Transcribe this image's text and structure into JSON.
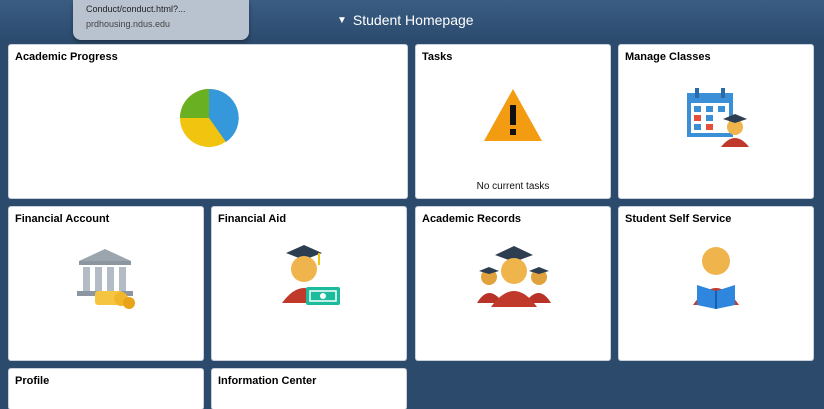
{
  "browser_tooltip": {
    "url_fragment": "Conduct/conduct.html?...",
    "host": "prdhousing.ndus.edu"
  },
  "header": {
    "title": "Student Homepage"
  },
  "tiles": {
    "academic_progress": "Academic Progress",
    "tasks": "Tasks",
    "tasks_status": "No current tasks",
    "manage_classes": "Manage Classes",
    "financial_account": "Financial Account",
    "financial_aid": "Financial Aid",
    "academic_records": "Academic Records",
    "student_self_service": "Student Self Service",
    "profile": "Profile",
    "information_center": "Information Center"
  },
  "icons": {
    "academic_progress": "pie-chart-icon",
    "tasks": "warning-icon",
    "manage_classes": "calendar-student-icon",
    "financial_account": "bank-money-icon",
    "financial_aid": "graduate-money-icon",
    "academic_records": "graduates-group-icon",
    "student_self_service": "student-reading-icon"
  },
  "colors": {
    "page_background": "#2c4a6b",
    "header_background": "#34567b",
    "warning": "#f39c12"
  }
}
